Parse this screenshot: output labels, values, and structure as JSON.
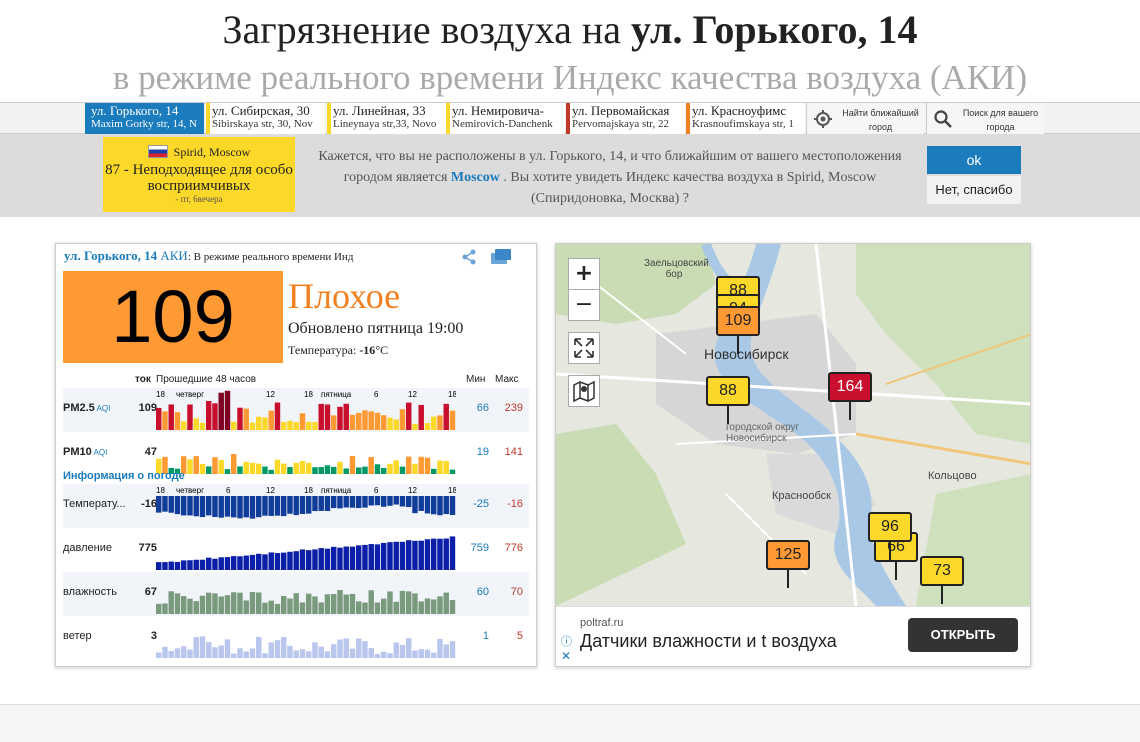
{
  "header": {
    "title_prefix": "Загрязнение воздуха на",
    "title_bold": "ул. Горького, 14",
    "subtitle": "в режиме реального времени Индекс качества воздуха (АКИ)"
  },
  "tabs": [
    {
      "l1": "ул. Горького, 14",
      "l2": "Maxim Gorky str, 14, N",
      "color": "#1a7bbd",
      "active": true
    },
    {
      "l1": "ул. Сибирская, 30",
      "l2": "Sibirskaya str, 30, Nov",
      "color": "#fcd928"
    },
    {
      "l1": "ул. Линейная, 33",
      "l2": "Lineynaya str,33, Novo",
      "color": "#fcd928"
    },
    {
      "l1": "ул. Немировича-",
      "l2": "Nemirovich-Danchenk",
      "color": "#fcd928"
    },
    {
      "l1": "ул. Первомайская",
      "l2": "Pervomajskaya str, 22",
      "color": "#c0392b"
    },
    {
      "l1": "ул. Красноуфимс",
      "l2": "Krasnoufimskaya str, 1",
      "color": "#f08020"
    }
  ],
  "tab_buttons": {
    "nearest": "Найти ближайший город",
    "search": "Поиск для вашего города"
  },
  "suggestion": {
    "city": "Spirid, Moscow",
    "level": "87 - Неподходящее для особо восприимчивых",
    "time": "- пт, 6вечера",
    "msg_1": "Кажется, что вы не расположены в ул. Горького, 14, и что ближайшим от вашего местоположения городом является",
    "msg_city": "Moscow",
    "msg_2": ". Вы хотите увидеть Индекс качества воздуха в Spirid, Moscow (Спиридоновка, Москва) ?",
    "ok": "ok",
    "no": "Нет, спасибо",
    "card_color": "#fcd928"
  },
  "widget": {
    "station": "ул. Горького, 14",
    "aqi_word": "АКИ",
    "realtime": ": В режиме реального времени Инд",
    "aqi": "109",
    "status": "Плохое",
    "updated": "Обновлено пятница 19:00",
    "temperature_label": "Температура:",
    "temperature_value": "-16",
    "temperature_unit": "°C",
    "col_current": "ток",
    "col_past": "Прошедшие 48 часов",
    "col_min": "Мин",
    "col_max": "Макс",
    "weather_info": "Информация о погоде",
    "day_labels": [
      "четверг",
      "пятница"
    ],
    "hour_ticks": [
      "18",
      "6",
      "12",
      "18",
      "6",
      "12",
      "18"
    ],
    "rows": [
      {
        "label": "PM2.5",
        "sub": "AQI",
        "cur": "109",
        "min": "66",
        "max": "239"
      },
      {
        "label": "PM10",
        "sub": "AQI",
        "cur": "47",
        "min": "19",
        "max": "141"
      },
      {
        "label": "Температу...",
        "cur": "-16",
        "min": "-25",
        "max": "-16"
      },
      {
        "label": "давление",
        "cur": "775",
        "min": "759",
        "max": "776"
      },
      {
        "label": "влажность",
        "cur": "67",
        "min": "60",
        "max": "70"
      },
      {
        "label": "ветер",
        "cur": "3",
        "min": "1",
        "max": "5"
      }
    ],
    "box_color": "#ff9933"
  },
  "map": {
    "labels": {
      "forest": "Заельцовский бор",
      "city": "Новосибирск",
      "okrug": "городской округ Новосибирск",
      "krasnoobsk": "Краснообск",
      "koltsovo": "Кольцово"
    },
    "pins": [
      {
        "v": "88",
        "color": "#fcd928"
      },
      {
        "v": "94",
        "color": "#fcd928"
      },
      {
        "v": "109",
        "color": "#ff9933"
      },
      {
        "v": "88",
        "color": "#fcd928"
      },
      {
        "v": "164",
        "color": "#c8102e"
      },
      {
        "v": "96",
        "color": "#fcd928"
      },
      {
        "v": "66",
        "color": "#fcd928"
      },
      {
        "v": "125",
        "color": "#ff9933"
      },
      {
        "v": "73",
        "color": "#fcd928"
      }
    ],
    "zoom_in": "+",
    "zoom_out": "−"
  },
  "ad": {
    "site": "poltraf.ru",
    "text": "Датчики влажности и t воздуха",
    "button": "ОТКРЫТЬ"
  }
}
